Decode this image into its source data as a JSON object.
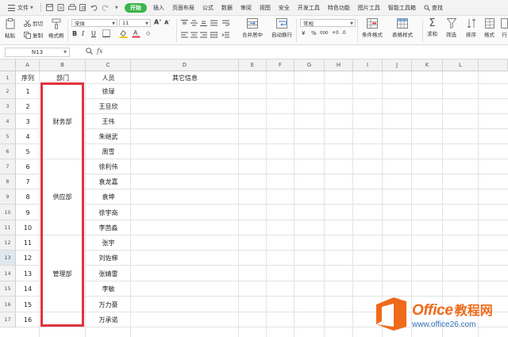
{
  "menu": {
    "file_label": "文件",
    "tabs": [
      "开始",
      "插入",
      "页面布局",
      "公式",
      "数据",
      "审阅",
      "视图",
      "安全",
      "开发工具",
      "特色功能",
      "图片工具",
      "智能工具箱"
    ],
    "active_tab": "开始",
    "search_label": "查找"
  },
  "ribbon": {
    "cut": "剪切",
    "paste": "粘贴",
    "copy": "复制",
    "format_painter": "格式刷",
    "font_name": "宋体",
    "font_size": "11",
    "merge_center": "合并居中",
    "wrap_text": "自动换行",
    "number_format": "常规",
    "currency_symbol": "¥",
    "percent_symbol": "%",
    "thousands_symbol": "000",
    "conditional_format": "条件格式",
    "table_style": "表格样式",
    "sum": "求和",
    "filter": "筛选",
    "sort": "排序",
    "format": "格式",
    "rows_cols": "行"
  },
  "formula_bar": {
    "name_box": "N13",
    "fx_label": "fx",
    "value": ""
  },
  "sheet": {
    "columns": [
      "A",
      "B",
      "C",
      "D",
      "E",
      "F",
      "G",
      "H",
      "I",
      "J",
      "K",
      "L"
    ],
    "row_numbers": [
      "1",
      "2",
      "3",
      "4",
      "5",
      "6",
      "7",
      "8",
      "9",
      "10",
      "11",
      "12",
      "13",
      "14",
      "15",
      "16",
      "17"
    ],
    "header": {
      "seq": "序列",
      "dept": "部门",
      "person": "人员",
      "info": "其它信息"
    },
    "seq_values": [
      "1",
      "2",
      "3",
      "4",
      "5",
      "6",
      "7",
      "8",
      "9",
      "10",
      "11",
      "12",
      "13",
      "14",
      "15",
      "16"
    ],
    "people": [
      "徐琭",
      "王旦欣",
      "王伟",
      "朱继武",
      "周雪",
      "徐利伟",
      "袁龙嘉",
      "袁坤",
      "徐宇商",
      "李茴淼",
      "张宇",
      "刘佐梯",
      "张婧雷",
      "李敏",
      "万力豪",
      "万承诺"
    ],
    "departments": [
      "财务部",
      "供应部",
      "管理部"
    ],
    "selected_row": "13",
    "highlight_color": "#e0343f"
  },
  "watermark": {
    "brand": "Office",
    "brand_cn": "教程网",
    "url": "www.office26.com"
  }
}
